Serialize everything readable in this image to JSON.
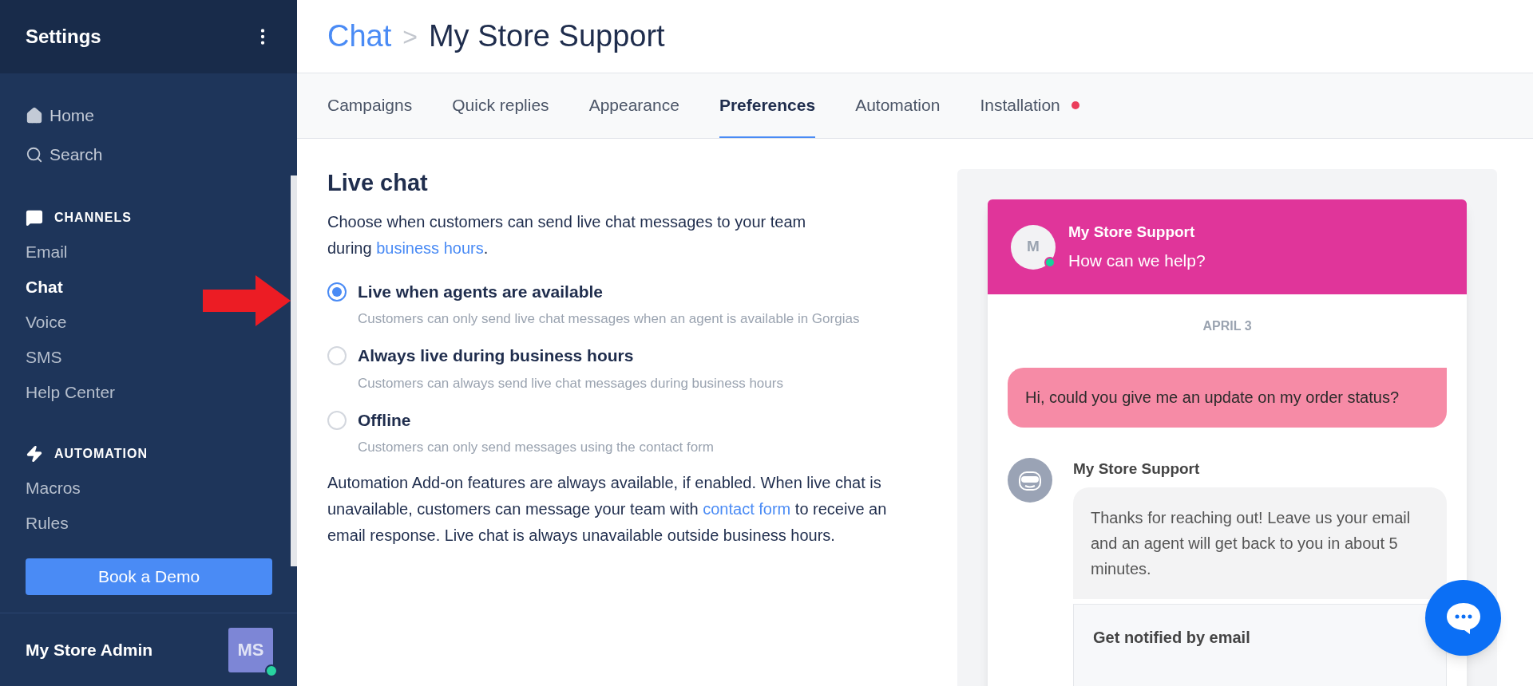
{
  "sidebar": {
    "title": "Settings",
    "nav": [
      {
        "label": "Home"
      },
      {
        "label": "Search"
      }
    ],
    "sections": [
      {
        "title": "CHANNELS",
        "items": [
          {
            "label": "Email",
            "selected": false
          },
          {
            "label": "Chat",
            "selected": true
          },
          {
            "label": "Voice",
            "selected": false
          },
          {
            "label": "SMS",
            "selected": false
          },
          {
            "label": "Help Center",
            "selected": false
          }
        ]
      },
      {
        "title": "AUTOMATION",
        "items": [
          {
            "label": "Macros",
            "selected": false
          },
          {
            "label": "Rules",
            "selected": false
          }
        ]
      }
    ],
    "demo_button": "Book a Demo",
    "user": {
      "name": "My Store Admin",
      "initials": "MS",
      "online": true
    }
  },
  "breadcrumb": {
    "parent": "Chat",
    "separator": ">",
    "current": "My Store Support"
  },
  "tabs": [
    {
      "label": "Campaigns",
      "selected": false,
      "alert": false
    },
    {
      "label": "Quick replies",
      "selected": false,
      "alert": false
    },
    {
      "label": "Appearance",
      "selected": false,
      "alert": false
    },
    {
      "label": "Preferences",
      "selected": true,
      "alert": false
    },
    {
      "label": "Automation",
      "selected": false,
      "alert": false
    },
    {
      "label": "Installation",
      "selected": false,
      "alert": true
    }
  ],
  "live_chat": {
    "title": "Live chat",
    "intro": "Choose when customers can send live chat messages to your team during ",
    "intro_link": "business hours",
    "intro_end": ".",
    "options": [
      {
        "label": "Live when agents are available",
        "description": "Customers can only send live chat messages when an agent is available in Gorgias",
        "selected": true
      },
      {
        "label": "Always live during business hours",
        "description": "Customers can always send live chat messages during business hours",
        "selected": false
      },
      {
        "label": "Offline",
        "description": "Customers can only send messages using the contact form",
        "selected": false
      }
    ],
    "note_start": "Automation Add-on features are always available, if enabled. When live chat is unavailable, customers can message your team with ",
    "note_link": "contact form",
    "note_end": " to receive an email response. Live chat is always unavailable outside business hours."
  },
  "preview": {
    "header": {
      "initial": "M",
      "name": "My Store Support",
      "tagline": "How can we help?",
      "online": true
    },
    "date": "APRIL 3",
    "customer_message": "Hi, could you give me an update on my order status?",
    "agent_name": "My Store Support",
    "agent_message": "Thanks for reaching out! Leave us your email and an agent will get back to you in about 5 minutes.",
    "email_card_title": "Get notified by email"
  }
}
